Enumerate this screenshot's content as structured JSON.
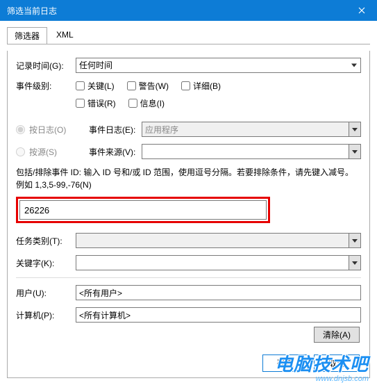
{
  "title": "筛选当前日志",
  "tabs": {
    "filter": "筛选器",
    "xml": "XML"
  },
  "labels": {
    "logged": "记录时间(G):",
    "level": "事件级别:",
    "byLog": "按日志(O)",
    "bySource": "按源(S)",
    "eventLog": "事件日志(E):",
    "eventSource": "事件来源(V):",
    "task": "任务类别(T):",
    "keywords": "关键字(K):",
    "user": "用户(U):",
    "computer": "计算机(P):"
  },
  "logged_value": "任何时间",
  "levels": {
    "critical": "关键(L)",
    "warning": "警告(W)",
    "verbose": "详细(B)",
    "error": "错误(R)",
    "info": "信息(I)"
  },
  "eventlog_value": "应用程序",
  "eventsource_value": "",
  "help_text": "包括/排除事件 ID: 输入 ID 号和/或 ID 范围，使用逗号分隔。若要排除条件，请先键入减号。例如 1,3,5-99,-76(N)",
  "id_value": "26226",
  "task_value": "",
  "keywords_value": "",
  "user_value": "<所有用户>",
  "computer_value": "<所有计算机>",
  "buttons": {
    "clear": "清除(A)",
    "ok": "确定",
    "cancel": "取消"
  },
  "overlay": {
    "brand": "电脑技术吧",
    "url": "www.dnjsb.com"
  }
}
